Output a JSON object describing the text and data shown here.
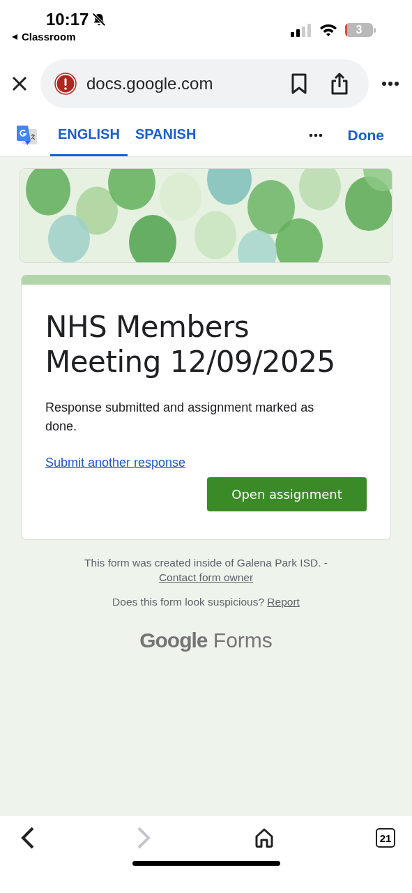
{
  "status_bar": {
    "time": "10:17",
    "back_app": "Classroom",
    "battery": "3"
  },
  "browser": {
    "url": "docs.google.com"
  },
  "translate_bar": {
    "tabs": [
      {
        "label": "ENGLISH",
        "selected": true
      },
      {
        "label": "SPANISH",
        "selected": false
      }
    ],
    "done": "Done"
  },
  "form": {
    "title": "NHS Members Meeting 12/09/2025",
    "message": "Response submitted and assignment marked as done.",
    "link": "Submit another response",
    "button": "Open assignment"
  },
  "footer": {
    "created": "This form was created inside of Galena Park ISD. - ",
    "contact_link": "Contact form owner",
    "suspicious": "Does this form look suspicious? ",
    "report_link": "Report",
    "logo_google": "Google",
    "logo_forms": "Forms"
  },
  "bottom_nav": {
    "back_disabled": false,
    "forward_disabled": true,
    "tab_count": "21"
  }
}
